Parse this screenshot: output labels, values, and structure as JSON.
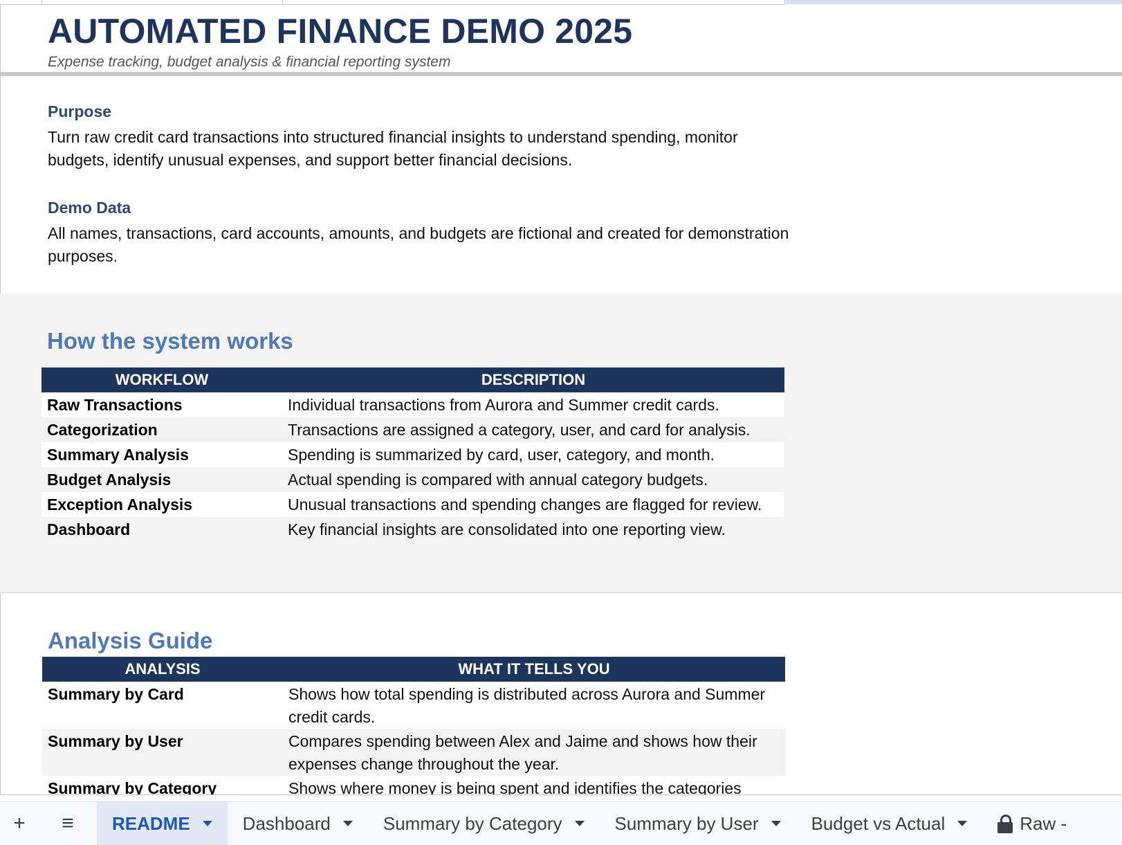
{
  "header": {
    "title": "AUTOMATED FINANCE DEMO 2025",
    "subtitle": "Expense tracking, budget analysis & financial reporting system"
  },
  "intro": {
    "purpose_label": "Purpose",
    "purpose_text": "Turn raw credit card transactions into structured financial insights to understand spending, monitor budgets, identify unusual expenses, and support better financial decisions.",
    "demo_label": "Demo Data",
    "demo_text": "All names, transactions, card accounts, amounts, and budgets are fictional and created for demonstration purposes."
  },
  "how": {
    "title": "How the system works",
    "col1": "WORKFLOW",
    "col2": "DESCRIPTION",
    "rows": [
      {
        "k": "Raw Transactions",
        "v": "Individual transactions from Aurora and Summer credit cards."
      },
      {
        "k": "Categorization",
        "v": "Transactions are assigned a category, user, and card for analysis."
      },
      {
        "k": "Summary Analysis",
        "v": "Spending is summarized by card, user, category, and month."
      },
      {
        "k": "Budget Analysis",
        "v": "Actual spending is compared with annual category budgets."
      },
      {
        "k": "Exception Analysis",
        "v": "Unusual transactions and spending changes are flagged for review."
      },
      {
        "k": "Dashboard",
        "v": "Key financial insights are consolidated into one reporting view."
      }
    ]
  },
  "guide": {
    "title": "Analysis Guide",
    "col1": "ANALYSIS",
    "col2": "WHAT IT TELLS YOU",
    "rows": [
      {
        "k": "Summary by Card",
        "v": "Shows how total spending is distributed across Aurora and Summer credit cards."
      },
      {
        "k": "Summary by User",
        "v": "Compares spending between Alex and Jaime and shows how their expenses change throughout the year."
      },
      {
        "k": "Summary by Category",
        "v": "Shows where money is being spent and identifies the categories"
      }
    ]
  },
  "tabs": {
    "add_symbol": "+",
    "menu_symbol": "≡",
    "items": [
      {
        "label": "README",
        "active": true
      },
      {
        "label": "Dashboard"
      },
      {
        "label": "Summary by Category"
      },
      {
        "label": "Summary by User"
      },
      {
        "label": "Budget vs Actual"
      },
      {
        "label": "Raw -"
      }
    ]
  },
  "colors": {
    "title": "#1b355c",
    "table_header": "#1b355c",
    "section_title": "#4f7ab8",
    "active_tab": "#1a56c0"
  }
}
